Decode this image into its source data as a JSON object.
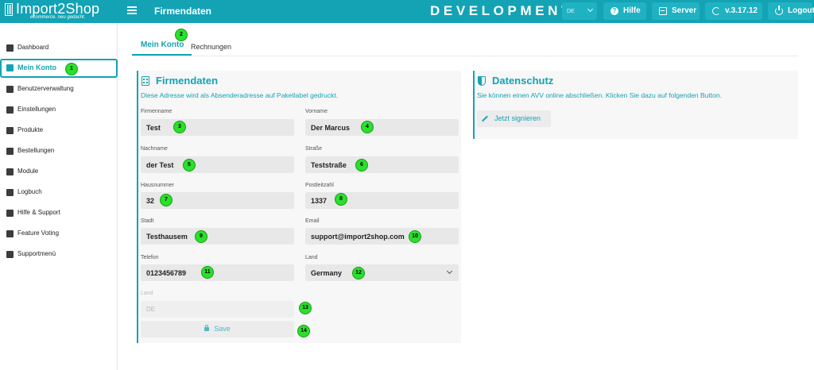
{
  "header": {
    "logo_text": "Import2Shop",
    "logo_subtitle": "ecommerce. neu gedacht.",
    "page_title": "Firmendaten",
    "environment": "DEVELOPMENT",
    "language": "DE",
    "help_label": "Hilfe",
    "server_label": "Server",
    "version_label": "v.3.17.12",
    "logout_label": "Logout",
    "accent_color": "#13a3b5"
  },
  "sidebar": {
    "items": [
      {
        "label": "Dashboard",
        "icon": "dashboard-icon"
      },
      {
        "label": "Mein Konto",
        "icon": "building-icon",
        "active": true
      },
      {
        "label": "Benutzerverwaltung",
        "icon": "users-icon"
      },
      {
        "label": "Einstellungen",
        "icon": "gears-icon"
      },
      {
        "label": "Produkte",
        "icon": "box-icon"
      },
      {
        "label": "Bestellungen",
        "icon": "cart-icon"
      },
      {
        "label": "Module",
        "icon": "puzzle-icon"
      },
      {
        "label": "Logbuch",
        "icon": "book-icon"
      },
      {
        "label": "Hilfe & Support",
        "icon": "support-icon"
      },
      {
        "label": "Feature Voting",
        "icon": "megaphone-icon"
      },
      {
        "label": "Supportmenü",
        "icon": "tools-icon"
      }
    ]
  },
  "tabs": [
    {
      "label": "Mein Konto",
      "active": true
    },
    {
      "label": "Rechnungen",
      "active": false
    }
  ],
  "company": {
    "title": "Firmendaten",
    "description": "Diese Adresse wird als Absenderadresse auf Paketlabel gedruckt.",
    "fields": {
      "firmenname": {
        "label": "Firmenname",
        "value": "Test"
      },
      "vorname": {
        "label": "Vorname",
        "value": "Der Marcus"
      },
      "nachname": {
        "label": "Nachname",
        "value": "der Test"
      },
      "strasse": {
        "label": "Straße",
        "value": "Teststraße"
      },
      "hausnummer": {
        "label": "Hausnummer",
        "value": "32"
      },
      "postleitzahl": {
        "label": "Postleitzahl",
        "value": "1337"
      },
      "stadt": {
        "label": "Stadt",
        "value": "Testhausem"
      },
      "email": {
        "label": "Email",
        "value": "support@import2shop.com"
      },
      "telefon": {
        "label": "Telefon",
        "value": "0123456789"
      },
      "land_select": {
        "label": "Land",
        "value": "Germany"
      },
      "land_code": {
        "label": "Land",
        "value": "DE"
      }
    },
    "save_label": "Save"
  },
  "privacy": {
    "title": "Datenschutz",
    "description": "Sie können einen AVV online abschließen. Klicken Sie dazu auf folgenden Button.",
    "sign_label": "Jetzt signieren"
  },
  "markers": [
    "1",
    "2",
    "3",
    "4",
    "5",
    "6",
    "7",
    "8",
    "9",
    "10",
    "11",
    "12",
    "13",
    "14"
  ]
}
